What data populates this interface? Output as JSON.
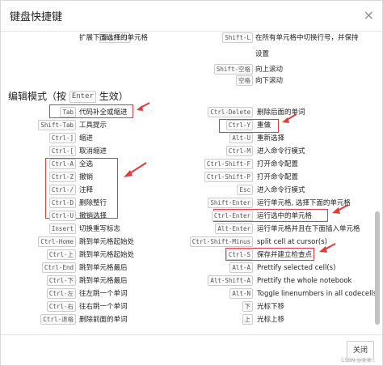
{
  "dialog": {
    "title": "键盘快捷键",
    "close_symbol": "×",
    "close_button": "关闭",
    "watermark": "CSDN @凌凌..."
  },
  "top_rows": {
    "left": [
      {
        "key": "Shift-J",
        "desc": "扩展下面选择的单元格"
      }
    ],
    "right": [
      {
        "key": "Shift-L",
        "desc": "在所有单元格中切换行号，并保持"
      },
      {
        "key": "",
        "desc": "设置"
      },
      {
        "key": "Shift-空格",
        "desc": "向上滚动"
      },
      {
        "key": "空格",
        "desc": "向下滚动"
      }
    ]
  },
  "edit_section": {
    "title_prefix": "编辑模式（按",
    "title_key": "Enter",
    "title_suffix": "生效）"
  },
  "left_rows": [
    {
      "key": "Tab",
      "desc": "代码补全或缩进"
    },
    {
      "key": "Shift-Tab",
      "desc": "工具提示"
    },
    {
      "key": "Ctrl-]",
      "desc": "缩进"
    },
    {
      "key": "Ctrl-[",
      "desc": "取消缩进"
    },
    {
      "key": "Ctrl-A",
      "desc": "全选"
    },
    {
      "key": "Ctrl-Z",
      "desc": "撤销"
    },
    {
      "key": "Ctrl-/",
      "desc": "注释"
    },
    {
      "key": "Ctrl-D",
      "desc": "删除整行"
    },
    {
      "key": "Ctrl-U",
      "desc": "撤销选择"
    },
    {
      "key": "Insert",
      "desc": "切换重写标志"
    },
    {
      "key": "Ctrl-Home",
      "desc": "跳到单元格起始处"
    },
    {
      "key": "Ctrl-上",
      "desc": "跳到单元格起始处"
    },
    {
      "key": "Ctrl-End",
      "desc": "跳到单元格最后"
    },
    {
      "key": "Ctrl-下",
      "desc": "跳到单元格最后"
    },
    {
      "key": "Ctrl-左",
      "desc": "往左跳一个单词"
    },
    {
      "key": "Ctrl-右",
      "desc": "往右跳一个单词"
    },
    {
      "key": "Ctrl-退格",
      "desc": "删除前面的单词"
    }
  ],
  "right_rows": [
    {
      "key": "Ctrl-Delete",
      "desc": "删除后面的单词"
    },
    {
      "key": "Ctrl-Y",
      "desc": "重做"
    },
    {
      "key": "Alt-U",
      "desc": "重新选择"
    },
    {
      "key": "Ctrl-M",
      "desc": "进入命令行模式"
    },
    {
      "key": "Ctrl-Shift-F",
      "desc": "打开命令配置"
    },
    {
      "key": "Ctrl-Shift-P",
      "desc": "打开命令配置"
    },
    {
      "key": "Esc",
      "desc": "进入命令行模式"
    },
    {
      "key": "Shift-Enter",
      "desc": "运行单元格, 选择下面的单元格"
    },
    {
      "key": "Ctrl-Enter",
      "desc": "运行选中的单元格"
    },
    {
      "key": "Alt-Enter",
      "desc": "运行单元格并且在下面插入单元格"
    },
    {
      "key": "Ctrl-Shift-Minus",
      "desc": "split cell at cursor(s)"
    },
    {
      "key": "Ctrl-S",
      "desc": "保存并建立检查点"
    },
    {
      "key": "Alt-A",
      "desc": "Prettify selected cell(s)"
    },
    {
      "key": "Alt-Shift-A",
      "desc": "Prettify the whole notebook"
    },
    {
      "key": "Alt-N",
      "desc": "Toggle linenumbers in all codecells"
    },
    {
      "key": "下",
      "desc": "光标下移"
    },
    {
      "key": "上",
      "desc": "光标上移"
    }
  ]
}
